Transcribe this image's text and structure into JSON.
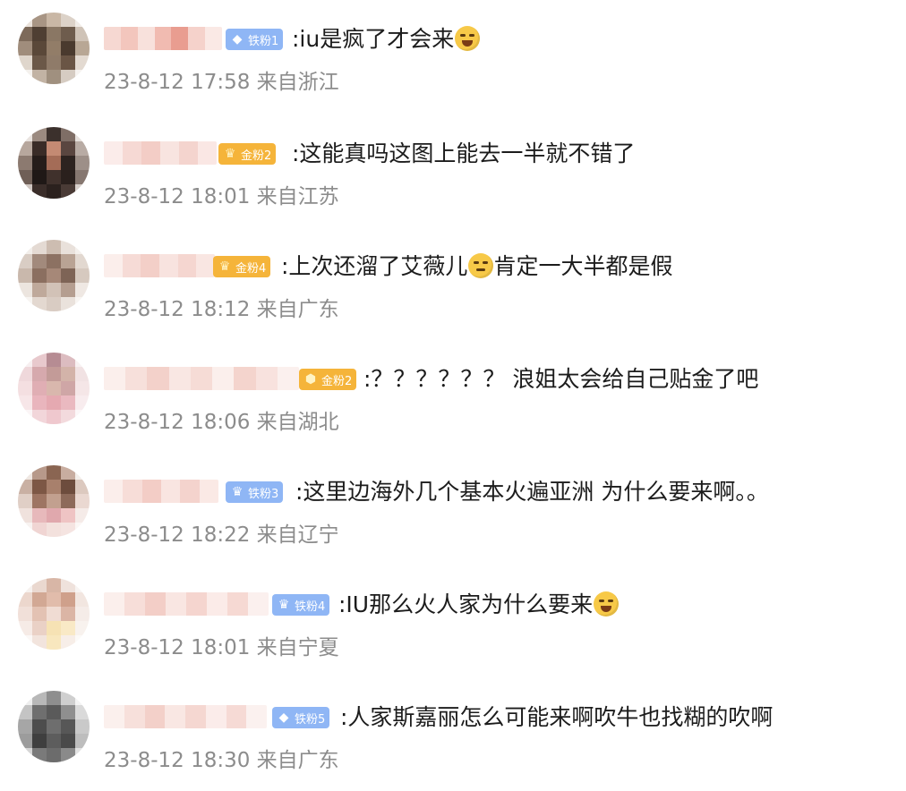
{
  "comments": [
    {
      "badge_type": "iron",
      "badge_icon": "diamond-icon",
      "badge_text": "铁粉1",
      "text": ":iu是疯了才会来",
      "emoji": "laugh-cry-emoji",
      "emoji_after": "",
      "time": "23-8-12 17:58",
      "location": "来自浙江"
    },
    {
      "badge_type": "gold",
      "badge_icon": "crown-icon",
      "badge_text": "金粉2",
      "text": ":这能真吗这图上能去一半就不错了",
      "emoji": "",
      "emoji_after": "",
      "time": "23-8-12 18:01",
      "location": "来自江苏"
    },
    {
      "badge_type": "gold",
      "badge_icon": "crown-icon",
      "badge_text": "金粉4",
      "text": ":上次还溜了艾薇儿",
      "emoji": "thinking-emoji",
      "emoji_after": "肯定一大半都是假",
      "time": "23-8-12 18:12",
      "location": "来自广东"
    },
    {
      "badge_type": "gold",
      "badge_icon": "diamond-icon",
      "badge_text": "金粉2",
      "text": ":？？？？？？ 浪姐太会给自己贴金了吧",
      "emoji": "",
      "emoji_after": "",
      "time": "23-8-12 18:06",
      "location": "来自湖北"
    },
    {
      "badge_type": "iron",
      "badge_icon": "crown-icon",
      "badge_text": "铁粉3",
      "text": ":这里边海外几个基本火遍亚洲 为什么要来啊。。",
      "emoji": "",
      "emoji_after": "",
      "time": "23-8-12 18:22",
      "location": "来自辽宁"
    },
    {
      "badge_type": "iron",
      "badge_icon": "crown-icon",
      "badge_text": "铁粉4",
      "text": ":IU那么火人家为什么要来",
      "emoji": "laugh-cry-emoji",
      "emoji_after": "",
      "time": "23-8-12 18:01",
      "location": "来自宁夏"
    },
    {
      "badge_type": "iron",
      "badge_icon": "diamond-icon",
      "badge_text": "铁粉5",
      "text": ":人家斯嘉丽怎么可能来啊吹牛也找糊的吹啊",
      "emoji": "",
      "emoji_after": "",
      "time": "23-8-12 18:30",
      "location": "来自广东"
    }
  ],
  "colors": {
    "iron_badge": "#8fb6f5",
    "gold_badge": "#f5b43a",
    "text": "#1c1c1c",
    "meta": "#8c8c8c"
  }
}
